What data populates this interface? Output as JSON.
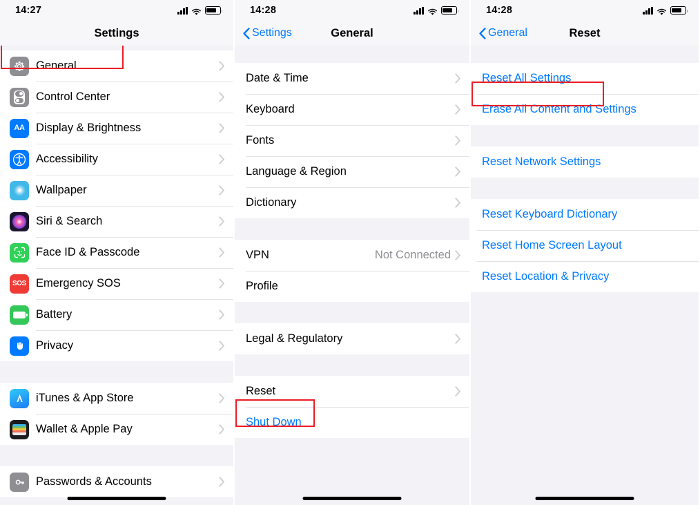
{
  "colors": {
    "accent": "#007aff",
    "highlight": "#ec1c24",
    "group_bg": "#f2f2f7",
    "row_bg": "#ffffff",
    "secondary_text": "#8e8e93"
  },
  "screens": [
    {
      "id": "settings",
      "status": {
        "time": "14:27",
        "signal": "cellular-signal-icon",
        "wifi": "wifi-icon",
        "battery": "battery-icon"
      },
      "nav": {
        "title": "Settings",
        "back": null
      },
      "sections": [
        {
          "rows": [
            {
              "label": "General",
              "icon": "gear-icon",
              "icon_class": "ic-gear",
              "chevron": true,
              "highlighted": true
            },
            {
              "label": "Control Center",
              "icon": "control-center-icon",
              "icon_class": "ic-cc",
              "chevron": true
            },
            {
              "label": "Display & Brightness",
              "icon": "display-brightness-icon",
              "icon_class": "ic-disp",
              "chevron": true
            },
            {
              "label": "Accessibility",
              "icon": "accessibility-icon",
              "icon_class": "ic-acc",
              "chevron": true
            },
            {
              "label": "Wallpaper",
              "icon": "wallpaper-icon",
              "icon_class": "ic-wall",
              "chevron": true
            },
            {
              "label": "Siri & Search",
              "icon": "siri-icon",
              "icon_class": "ic-siri",
              "chevron": true
            },
            {
              "label": "Face ID & Passcode",
              "icon": "face-id-icon",
              "icon_class": "ic-face",
              "chevron": true
            },
            {
              "label": "Emergency SOS",
              "icon": "emergency-sos-icon",
              "icon_class": "ic-sos",
              "chevron": true
            },
            {
              "label": "Battery",
              "icon": "battery-settings-icon",
              "icon_class": "ic-batt",
              "chevron": true
            },
            {
              "label": "Privacy",
              "icon": "privacy-hand-icon",
              "icon_class": "ic-priv",
              "chevron": true
            }
          ]
        },
        {
          "rows": [
            {
              "label": "iTunes & App Store",
              "icon": "app-store-icon",
              "icon_class": "ic-itun",
              "chevron": true
            },
            {
              "label": "Wallet & Apple Pay",
              "icon": "wallet-icon",
              "icon_class": "ic-wlt",
              "chevron": true
            }
          ]
        },
        {
          "rows": [
            {
              "label": "Passwords & Accounts",
              "icon": "passwords-icon",
              "icon_class": "ic-pwd",
              "chevron": true
            }
          ]
        }
      ]
    },
    {
      "id": "general",
      "status": {
        "time": "14:28",
        "signal": "cellular-signal-icon",
        "wifi": "wifi-icon",
        "battery": "battery-icon"
      },
      "nav": {
        "title": "General",
        "back": "Settings"
      },
      "sections": [
        {
          "rows": [
            {
              "label": "Date & Time",
              "chevron": true
            },
            {
              "label": "Keyboard",
              "chevron": true
            },
            {
              "label": "Fonts",
              "chevron": true
            },
            {
              "label": "Language & Region",
              "chevron": true
            },
            {
              "label": "Dictionary",
              "chevron": true
            }
          ]
        },
        {
          "rows": [
            {
              "label": "VPN",
              "value": "Not Connected",
              "chevron": true
            },
            {
              "label": "Profile",
              "chevron": false
            }
          ]
        },
        {
          "rows": [
            {
              "label": "Legal & Regulatory",
              "chevron": true
            }
          ]
        },
        {
          "rows": [
            {
              "label": "Reset",
              "chevron": true,
              "highlighted": true
            },
            {
              "label": "Shut Down",
              "chevron": false,
              "link": true
            }
          ]
        }
      ]
    },
    {
      "id": "reset",
      "status": {
        "time": "14:28",
        "signal": "cellular-signal-icon",
        "wifi": "wifi-icon",
        "battery": "battery-icon"
      },
      "nav": {
        "title": "Reset",
        "back": "General"
      },
      "sections": [
        {
          "rows": [
            {
              "label": "Reset All Settings",
              "link": true,
              "highlighted": true
            },
            {
              "label": "Erase All Content and Settings",
              "link": true
            }
          ]
        },
        {
          "rows": [
            {
              "label": "Reset Network Settings",
              "link": true
            }
          ]
        },
        {
          "rows": [
            {
              "label": "Reset Keyboard Dictionary",
              "link": true
            },
            {
              "label": "Reset Home Screen Layout",
              "link": true
            },
            {
              "label": "Reset Location & Privacy",
              "link": true
            }
          ]
        }
      ]
    }
  ]
}
